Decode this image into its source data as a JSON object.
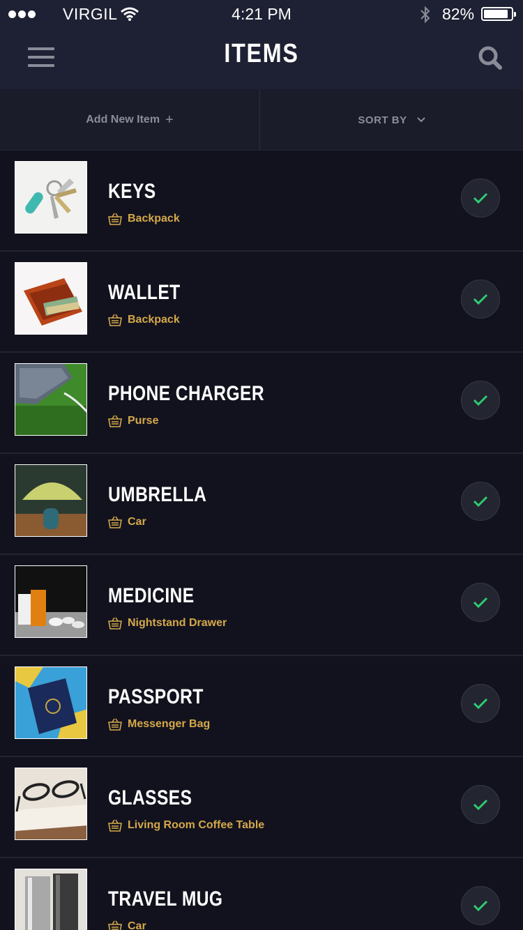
{
  "status": {
    "carrier": "VIRGIL",
    "time": "4:21 PM",
    "battery": "82%"
  },
  "nav": {
    "title": "ITEMS",
    "menu_icon": "hamburger-menu-icon",
    "search_icon": "search-icon"
  },
  "actions": {
    "add_label": "Add New Item",
    "add_icon": "+",
    "sort_label": "SORT BY"
  },
  "colors": {
    "location": "#d5a94a",
    "check": "#2ecc71",
    "header": "#1e2133",
    "background": "#12121e"
  },
  "items": [
    {
      "name": "KEYS",
      "location": "Backpack",
      "checked": true
    },
    {
      "name": "WALLET",
      "location": "Backpack",
      "checked": true
    },
    {
      "name": "PHONE CHARGER",
      "location": "Purse",
      "checked": true
    },
    {
      "name": "UMBRELLA",
      "location": "Car",
      "checked": true
    },
    {
      "name": "MEDICINE",
      "location": "Nightstand Drawer",
      "checked": true
    },
    {
      "name": "PASSPORT",
      "location": "Messenger Bag",
      "checked": true
    },
    {
      "name": "GLASSES",
      "location": "Living Room Coffee Table",
      "checked": true
    },
    {
      "name": "TRAVEL MUG",
      "location": "Car",
      "checked": true
    }
  ]
}
